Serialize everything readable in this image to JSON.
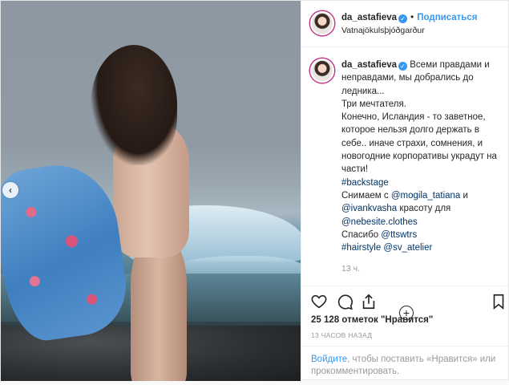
{
  "post": {
    "username": "da_astafieva",
    "follow_label": "Подписаться",
    "location": "Vatnajökulsþjóðgarður",
    "caption": {
      "text1": "Всеми правдами и неправдами, мы добрались до ледника...",
      "text2": "Три мечтателя.",
      "text3": "Конечно, Исландия - то заветное, которое нельзя долго держать в себе.. иначе страхи, сомнения, и новогодние корпоративы украдут на части!",
      "hashtag_backstage": "#backstage",
      "shot_by": "Снимаем с",
      "mention_mogila": "@mogila_tatiana",
      "and": "и",
      "mention_ivank": "@ivankvasha",
      "beauty_for": "красоту для",
      "mention_nebesite": "@nebesite.clothes",
      "thanks": "Спасибо",
      "mention_ttswtrs": "@ttswtrs",
      "hashtag_hairstyle": "#hairstyle",
      "mention_sv": "@sv_atelier"
    },
    "caption_time": "13 ч.",
    "likes": "25 128 отметок \"Нравится\"",
    "time_ago": "13 ЧАСОВ НАЗАД",
    "login_link": "Войдите",
    "login_rest": ", чтобы поставить «Нравится» или прокомментировать."
  },
  "icons": [
    "heart-icon",
    "comment-icon",
    "share-icon",
    "bookmark-icon",
    "add-comment-icon",
    "chevron-left-icon",
    "verified-icon"
  ],
  "colors": {
    "accent": "#3897f0",
    "link": "#003569",
    "muted": "#999999",
    "text": "#262626"
  }
}
